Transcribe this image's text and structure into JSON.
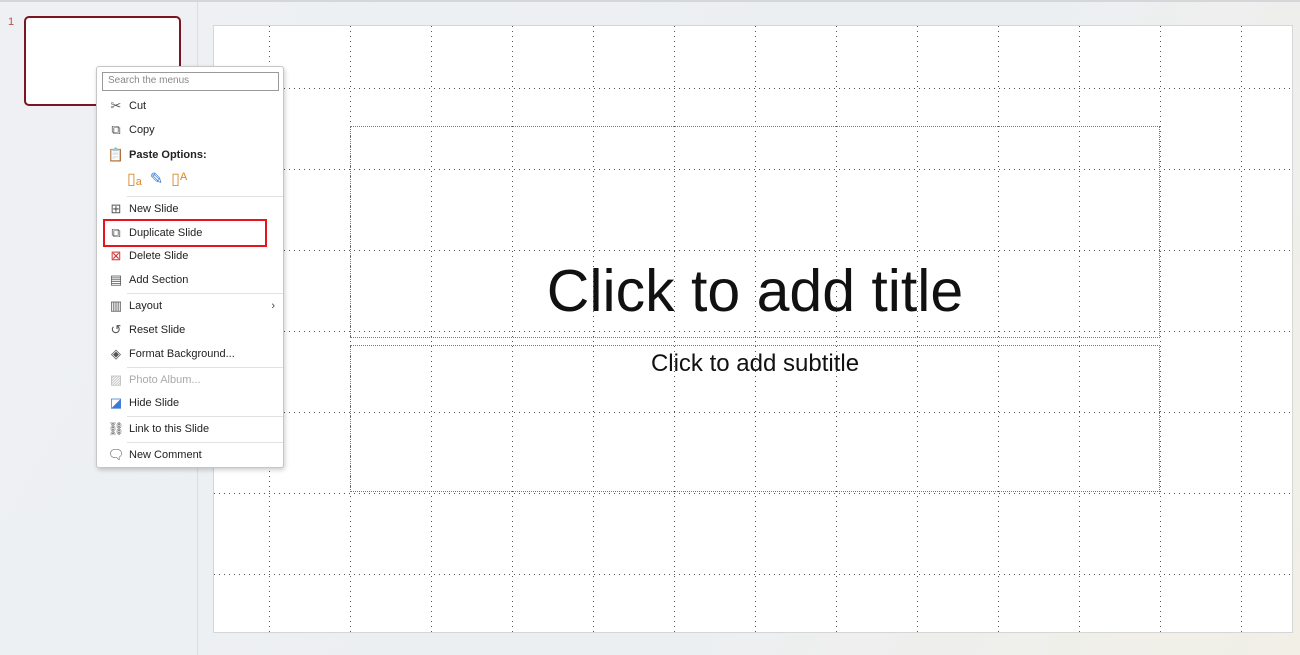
{
  "thumbnails": [
    {
      "number": "1"
    }
  ],
  "slide": {
    "title_placeholder": "Click to add title",
    "subtitle_placeholder": "Click to add subtitle"
  },
  "context_menu": {
    "search_placeholder": "Search the menus",
    "items": [
      {
        "label": "Cut",
        "icon": "scissors-icon"
      },
      {
        "label": "Copy",
        "icon": "copy-icon"
      },
      {
        "label": "Paste Options:",
        "icon": "paste-icon"
      },
      {
        "label": "New Slide",
        "icon": "new-slide-icon"
      },
      {
        "label": "Duplicate Slide",
        "icon": "duplicate-slide-icon",
        "highlighted": true
      },
      {
        "label": "Delete Slide",
        "icon": "delete-slide-icon"
      },
      {
        "label": "Add Section",
        "icon": "section-icon"
      },
      {
        "label": "Layout",
        "icon": "layout-icon",
        "submenu": true
      },
      {
        "label": "Reset Slide",
        "icon": "reset-icon"
      },
      {
        "label": "Format Background...",
        "icon": "format-background-icon"
      },
      {
        "label": "Photo Album...",
        "icon": "photo-album-icon",
        "disabled": true
      },
      {
        "label": "Hide Slide",
        "icon": "hide-slide-icon"
      },
      {
        "label": "Link to this Slide",
        "icon": "link-icon"
      },
      {
        "label": "New Comment",
        "icon": "comment-icon"
      }
    ],
    "paste_options": [
      "keep-source-formatting-icon",
      "use-destination-theme-icon",
      "keep-text-only-icon"
    ]
  },
  "colors": {
    "highlight_border": "#e8141c",
    "thumbnail_selected": "#7b1523"
  }
}
